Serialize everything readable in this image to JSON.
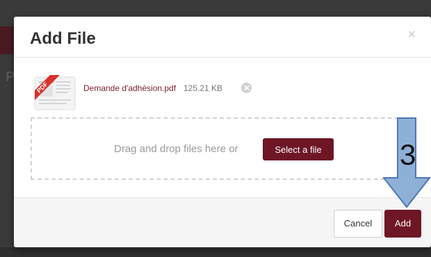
{
  "modal": {
    "title": "Add File",
    "close_glyph": "×",
    "close_icon": "close-icon"
  },
  "file": {
    "name": "Demande d'adhésion.pdf",
    "size": "125.21 KB",
    "icon": "pdf-file-icon",
    "icon_badge": "PDF",
    "remove_icon": "remove-file-icon"
  },
  "dropzone": {
    "text": "Drag and drop files here or",
    "select_label": "Select a file"
  },
  "footer": {
    "cancel_label": "Cancel",
    "add_label": "Add"
  },
  "annotation": {
    "number": "3",
    "arrow_color": "#8fb0d6",
    "arrow_border_color": "#4a78b0"
  },
  "colors": {
    "accent": "#6e1625",
    "file_link": "#7a1c2c",
    "overlay": "#3a3a3a"
  }
}
